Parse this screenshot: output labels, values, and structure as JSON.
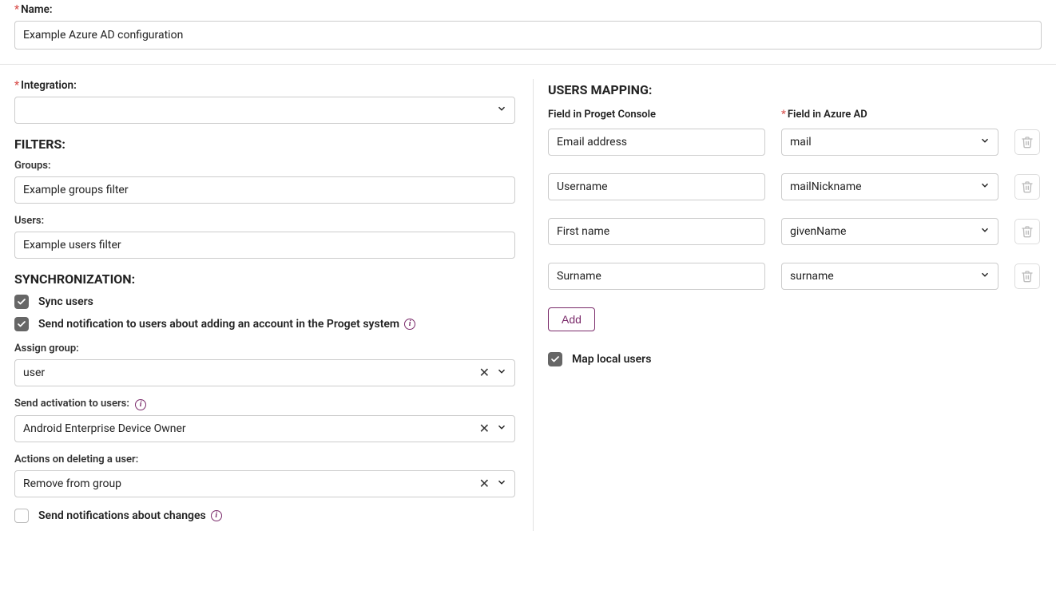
{
  "top": {
    "name_label": "Name:",
    "name_value": "Example Azure AD configuration"
  },
  "left": {
    "integration_label": "Integration:",
    "integration_value": "",
    "filters_heading": "FILTERS:",
    "groups_label": "Groups:",
    "groups_value": "Example groups filter",
    "users_label": "Users:",
    "users_value": "Example users filter",
    "sync_heading": "SYNCHRONIZATION:",
    "sync_users_label": "Sync users",
    "send_notification_label": "Send notification to users about adding an account in the Proget system",
    "assign_group_label": "Assign group:",
    "assign_group_value": "user",
    "send_activation_label": "Send activation to users:",
    "send_activation_value": "Android Enterprise Device Owner",
    "actions_delete_label": "Actions on deleting a user:",
    "actions_delete_value": "Remove from group",
    "send_changes_label": "Send notifications about changes"
  },
  "right": {
    "heading": "USERS MAPPING:",
    "col_a_label": "Field in Proget Console",
    "col_b_label": "Field in Azure AD",
    "rows": [
      {
        "console": "Email address",
        "azure": "mail"
      },
      {
        "console": "Username",
        "azure": "mailNickname"
      },
      {
        "console": "First name",
        "azure": "givenName"
      },
      {
        "console": "Surname",
        "azure": "surname"
      }
    ],
    "add_label": "Add",
    "map_local_label": "Map local users"
  }
}
